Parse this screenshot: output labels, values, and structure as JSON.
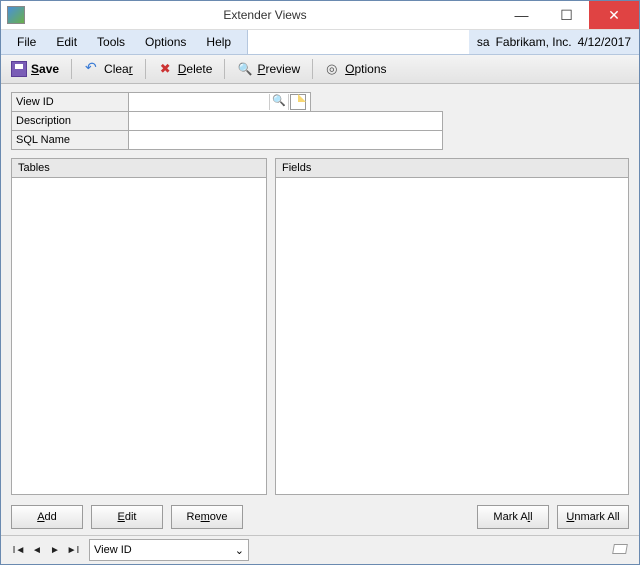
{
  "titlebar": {
    "title": "Extender Views"
  },
  "menu": {
    "items": [
      "File",
      "Edit",
      "Tools",
      "Options",
      "Help"
    ],
    "user": "sa",
    "company": "Fabrikam, Inc.",
    "date": "4/12/2017"
  },
  "toolbar": {
    "save": "Save",
    "clear": "Clear",
    "delete": "Delete",
    "preview": "Preview",
    "options": "Options"
  },
  "form": {
    "viewid_label": "View ID",
    "viewid_value": "",
    "description_label": "Description",
    "description_value": "",
    "sqlname_label": "SQL Name",
    "sqlname_value": ""
  },
  "panels": {
    "tables_title": "Tables",
    "fields_title": "Fields"
  },
  "buttons": {
    "add": "Add",
    "edit": "Edit",
    "remove": "Remove",
    "mark_all": "Mark All",
    "unmark_all": "Unmark All"
  },
  "nav": {
    "selector_value": "View ID"
  }
}
